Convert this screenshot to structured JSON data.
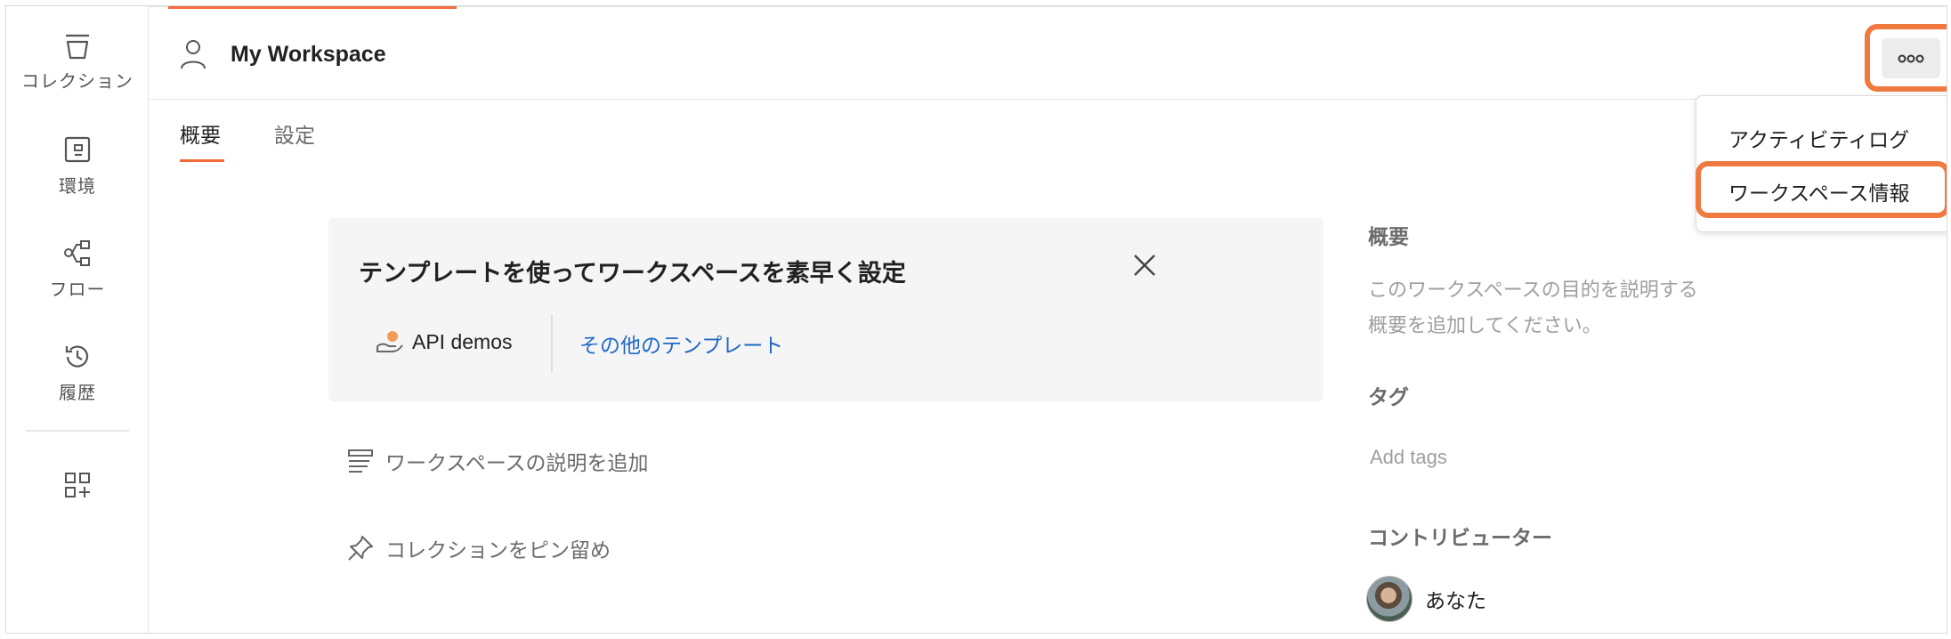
{
  "sidebar": {
    "items": [
      {
        "label": "コレクション",
        "icon": "collections-icon"
      },
      {
        "label": "環境",
        "icon": "environment-icon"
      },
      {
        "label": "フロー",
        "icon": "flows-icon"
      },
      {
        "label": "履歴",
        "icon": "history-icon"
      }
    ],
    "bottom_icon": "add-apps-icon"
  },
  "header": {
    "title": "My Workspace",
    "user_icon": "person-icon",
    "more_icon": "more-options-icon"
  },
  "tabs": [
    {
      "label": "概要",
      "active": true
    },
    {
      "label": "設定",
      "active": false
    }
  ],
  "template_card": {
    "title": "テンプレートを使ってワークスペースを素早く設定",
    "api_demos_label": "API demos",
    "more_templates_label": "その他のテンプレート"
  },
  "actions": {
    "add_description": "ワークスペースの説明を追加",
    "pin_collections": "コレクションをピン留め"
  },
  "right_panel": {
    "overview_heading": "概要",
    "overview_placeholder_line1": "このワークスペースの目的を説明する",
    "overview_placeholder_line2": "概要を追加してください。",
    "tags_heading": "タグ",
    "tags_placeholder": "Add tags",
    "contributors_heading": "コントリビューター",
    "contributor_name": "あなた"
  },
  "menu": {
    "items": [
      "アクティビティログ",
      "ワークスペース情報"
    ]
  },
  "colors": {
    "accent": "#f26b3a",
    "highlight": "#f0793f",
    "link": "#1f69c9"
  }
}
